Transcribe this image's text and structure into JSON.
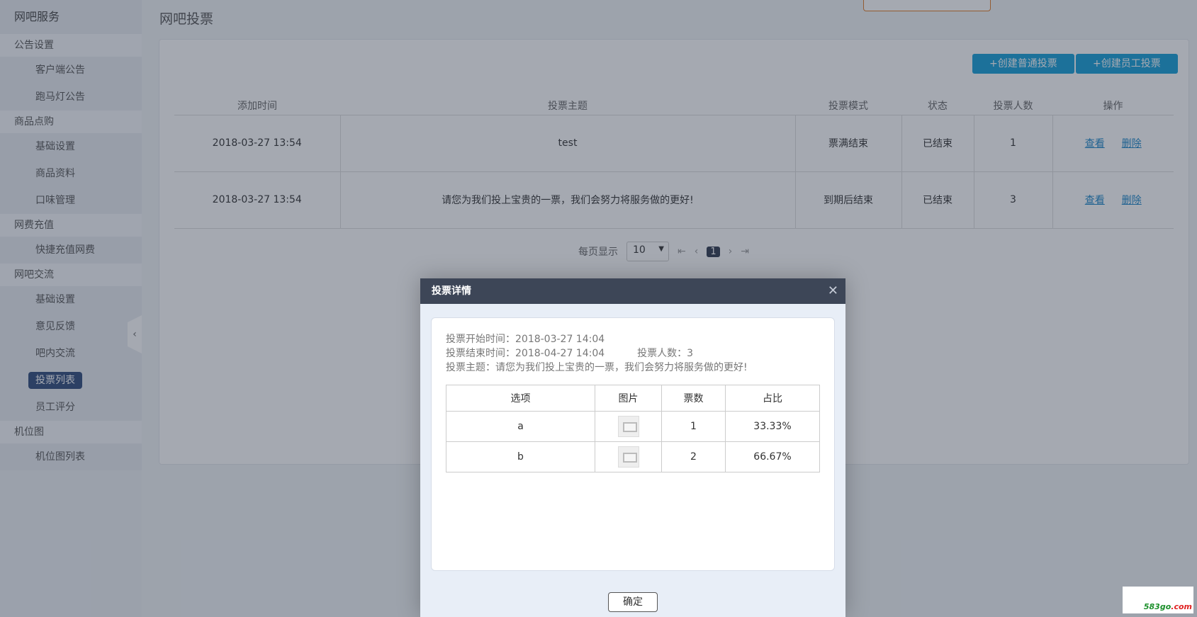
{
  "sidebar": {
    "top": "网吧服务",
    "groups": [
      {
        "label": "公告设置",
        "items": [
          "客户端公告",
          "跑马灯公告"
        ]
      },
      {
        "label": "商品点购",
        "items": [
          "基础设置",
          "商品资料",
          "口味管理"
        ]
      },
      {
        "label": "网费充值",
        "items": [
          "快捷充值网费"
        ]
      },
      {
        "label": "网吧交流",
        "items": [
          "基础设置",
          "意见反馈",
          "吧内交流",
          "投票列表",
          "员工评分"
        ]
      },
      {
        "label": "机位图",
        "items": [
          "机位图列表"
        ]
      }
    ],
    "active_item": "投票列表"
  },
  "page": {
    "title": "网吧投票",
    "create_normal": "+创建普通投票",
    "create_staff": "+创建员工投票"
  },
  "table": {
    "headers": [
      "添加时间",
      "投票主题",
      "投票模式",
      "状态",
      "投票人数",
      "操作"
    ],
    "rows": [
      {
        "time": "2018-03-27 13:54",
        "topic": "test",
        "mode": "票满结束",
        "status": "已结束",
        "count": "1",
        "view": "查看",
        "delete": "删除"
      },
      {
        "time": "2018-03-27 13:54",
        "topic": "请您为我们投上宝贵的一票，我们会努力将服务做的更好!",
        "mode": "到期后结束",
        "status": "已结束",
        "count": "3",
        "view": "查看",
        "delete": "删除"
      }
    ]
  },
  "pager": {
    "per_page_label": "每页显示",
    "per_page_value": "10",
    "current_page": "1"
  },
  "modal": {
    "title": "投票详情",
    "start_time": "投票开始时间：2018-03-27 14:04",
    "end_time": "投票结束时间：2018-04-27 14:04",
    "voters": "投票人数：3",
    "topic": "投票主题：请您为我们投上宝贵的一票，我们会努力将服务做的更好!",
    "headers": [
      "选项",
      "图片",
      "票数",
      "占比"
    ],
    "options": [
      {
        "name": "a",
        "votes": "1",
        "share": "33.33%"
      },
      {
        "name": "b",
        "votes": "2",
        "share": "66.67%"
      }
    ],
    "ok": "确定"
  },
  "watermark": {
    "main": "583go",
    "suffix": ".com"
  },
  "colors": {
    "accent": "#149fd8",
    "status_ended": "#e07b25",
    "modal_header": "#3d4657",
    "active_nav": "#2f4a7a"
  }
}
